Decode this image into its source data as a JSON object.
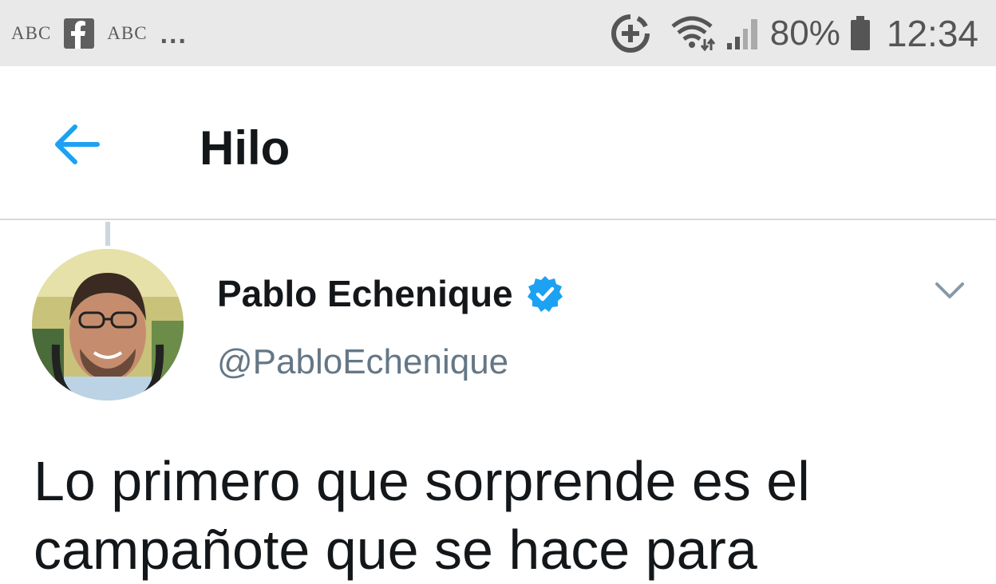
{
  "status_bar": {
    "notifications": [
      "ABC",
      "facebook-icon",
      "ABC"
    ],
    "more": "...",
    "battery": "80%",
    "time": "12:34",
    "icons": [
      "data-saver-icon",
      "wifi-icon",
      "signal-icon",
      "battery-icon"
    ]
  },
  "toolbar": {
    "title": "Hilo",
    "back_icon": "arrow-left-icon",
    "accent_color": "#1da1f2"
  },
  "tweet": {
    "author_name": "Pablo Echenique",
    "handle": "@PabloEchenique",
    "verified": true,
    "text_line1": "Lo primero que sorprende es el",
    "text_line2": "campañote que se hace para"
  }
}
